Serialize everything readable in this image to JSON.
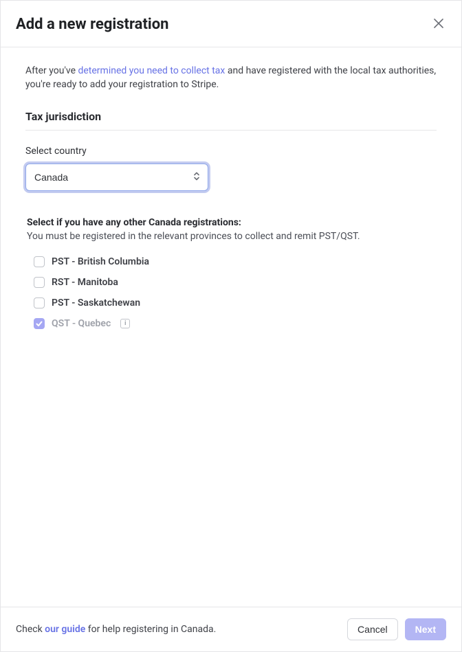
{
  "header": {
    "title": "Add a new registration"
  },
  "intro": {
    "before_link": "After you've ",
    "link_text": "determined you need to collect tax",
    "after_link": " and have registered with the local tax authorities, you're ready to add your registration to Stripe."
  },
  "jurisdiction": {
    "section_title": "Tax jurisdiction",
    "country_label": "Select country",
    "country_value": "Canada"
  },
  "other_regs": {
    "title": "Select if you have any other Canada registrations:",
    "desc": "You must be registered in the relevant provinces to collect and remit PST/QST.",
    "items": [
      {
        "label": "PST - British Columbia",
        "checked": false,
        "muted": false,
        "has_info": false
      },
      {
        "label": "RST - Manitoba",
        "checked": false,
        "muted": false,
        "has_info": false
      },
      {
        "label": "PST - Saskatchewan",
        "checked": false,
        "muted": false,
        "has_info": false
      },
      {
        "label": "QST - Quebec",
        "checked": true,
        "muted": true,
        "has_info": true
      }
    ]
  },
  "footer": {
    "before_link": "Check ",
    "link_text": "our guide",
    "after_link": " for help registering in Canada.",
    "cancel": "Cancel",
    "next": "Next"
  }
}
